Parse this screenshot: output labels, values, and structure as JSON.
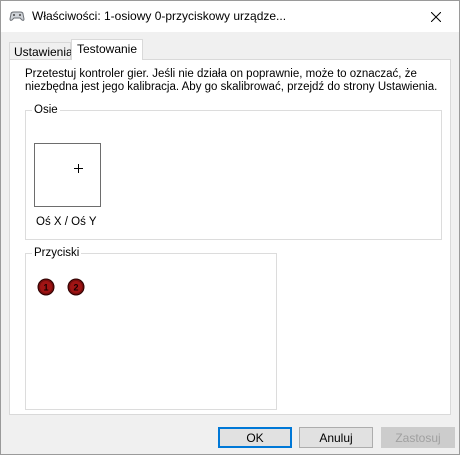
{
  "window": {
    "title": "Właściwości: 1-osiowy 0-przyciskowy urządze..."
  },
  "tabs": [
    {
      "label": "Ustawienia",
      "active": false
    },
    {
      "label": "Testowanie",
      "active": true
    }
  ],
  "testing": {
    "description": "Przetestuj kontroler gier. Jeśli nie działa on poprawnie, może to oznaczać, że niezbędna jest jego kalibracja. Aby go skalibrować, przejdź do strony Ustawienia.",
    "axes": {
      "label": "Osie",
      "caption": "Oś X / Oś Y"
    },
    "buttons": {
      "label": "Przyciski",
      "items": [
        {
          "number": "1",
          "color": "#a01414"
        },
        {
          "number": "2",
          "color": "#a01414"
        }
      ]
    }
  },
  "footer": {
    "ok_label": "OK",
    "cancel_label": "Anuluj",
    "apply_label": "Zastosuj",
    "apply_enabled": false
  },
  "colors": {
    "focus_border": "#0078d7",
    "button_bg": "#e1e1e1",
    "panel_bg": "#ffffff",
    "dialog_bg": "#f0f0f0"
  }
}
